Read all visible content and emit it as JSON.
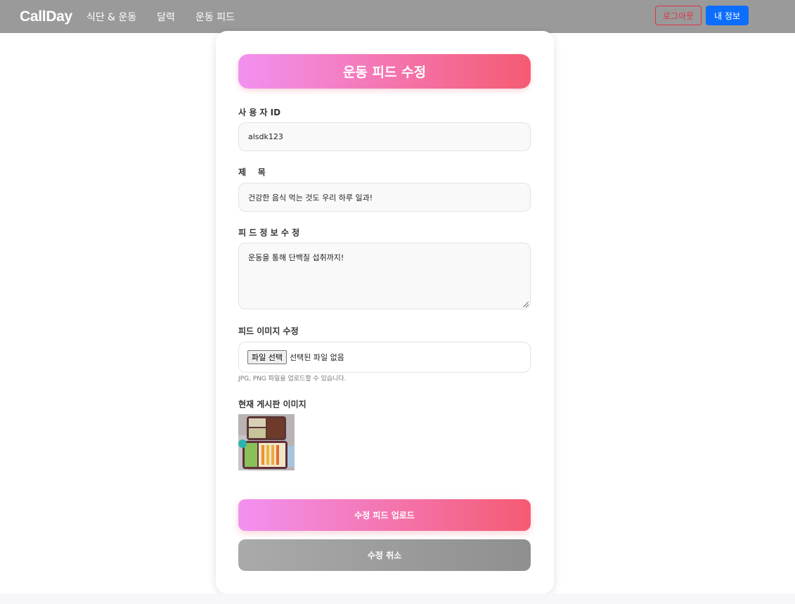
{
  "navbar": {
    "brand": "CallDay",
    "links": [
      "식단 & 운동",
      "달력",
      "운동 피드"
    ],
    "logout_label": "로그아웃",
    "myinfo_label": "내 정보"
  },
  "form": {
    "title": "운동 피드 수정",
    "user_id_label": "사 용 자 ID",
    "user_id_value": "alsdk123",
    "subject_label": "제    목",
    "subject_value": "건강한 음식 먹는 것도 우리 하루 일과!",
    "info_label": "피 드 정 보 수 정",
    "info_value": "운동을 통해 단백질 섭취까지!",
    "image_label": "피드 이미지 수정",
    "file_button_label": "파일 선택",
    "file_status": "선택된 파일 없음",
    "file_hint": "JPG, PNG 파일을 업로드할 수 있습니다.",
    "current_image_label": "현재 게시판 이미지",
    "upload_label": "수정 피드 업로드",
    "cancel_label": "수정 취소"
  },
  "colors": {
    "gradient_start": "#f291f0",
    "gradient_end": "#f55b72",
    "navbar_bg": "#9a9a9a",
    "logout": "#dc3545",
    "myinfo": "#0d6efd"
  }
}
